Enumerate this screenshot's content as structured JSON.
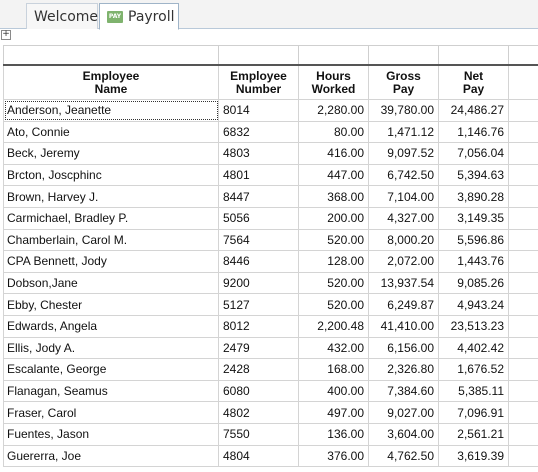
{
  "tabs": [
    {
      "label": "Welcome",
      "active": false
    },
    {
      "label": "Payroll",
      "active": true,
      "badge": "PAY"
    }
  ],
  "expander": "+",
  "columns": [
    {
      "line1": "Employee",
      "line2": "Name"
    },
    {
      "line1": "Employee",
      "line2": "Number"
    },
    {
      "line1": "Hours",
      "line2": "Worked"
    },
    {
      "line1": "Gross",
      "line2": "Pay"
    },
    {
      "line1": "Net",
      "line2": "Pay"
    }
  ],
  "rows": [
    {
      "name": "Anderson, Jeanette",
      "number": "8014",
      "hours": "2,280.00",
      "gross": "39,780.00",
      "net": "24,486.27"
    },
    {
      "name": "Ato, Connie",
      "number": "6832",
      "hours": "80.00",
      "gross": "1,471.12",
      "net": "1,146.76"
    },
    {
      "name": "Beck, Jeremy",
      "number": "4803",
      "hours": "416.00",
      "gross": "9,097.52",
      "net": "7,056.04"
    },
    {
      "name": "Brcton, Joscphinc",
      "number": "4801",
      "hours": "447.00",
      "gross": "6,742.50",
      "net": "5,394.63"
    },
    {
      "name": "Brown, Harvey J.",
      "number": "8447",
      "hours": "368.00",
      "gross": "7,104.00",
      "net": "3,890.28"
    },
    {
      "name": "Carmichael, Bradley P.",
      "number": "5056",
      "hours": "200.00",
      "gross": "4,327.00",
      "net": "3,149.35"
    },
    {
      "name": "Chamberlain, Carol M.",
      "number": "7564",
      "hours": "520.00",
      "gross": "8,000.20",
      "net": "5,596.86"
    },
    {
      "name": "CPA Bennett, Jody",
      "number": "8446",
      "hours": "128.00",
      "gross": "2,072.00",
      "net": "1,443.76"
    },
    {
      "name": "Dobson,Jane",
      "number": "9200",
      "hours": "520.00",
      "gross": "13,937.54",
      "net": "9,085.26"
    },
    {
      "name": "Ebby, Chester",
      "number": "5127",
      "hours": "520.00",
      "gross": "6,249.87",
      "net": "4,943.24"
    },
    {
      "name": "Edwards, Angela",
      "number": "8012",
      "hours": "2,200.48",
      "gross": "41,410.00",
      "net": "23,513.23"
    },
    {
      "name": "Ellis, Jody A.",
      "number": "2479",
      "hours": "432.00",
      "gross": "6,156.00",
      "net": "4,402.42"
    },
    {
      "name": "Escalante, George",
      "number": "2428",
      "hours": "168.00",
      "gross": "2,326.80",
      "net": "1,676.52"
    },
    {
      "name": "Flanagan, Seamus",
      "number": "6080",
      "hours": "400.00",
      "gross": "7,384.60",
      "net": "5,385.11"
    },
    {
      "name": "Fraser, Carol",
      "number": "4802",
      "hours": "497.00",
      "gross": "9,027.00",
      "net": "7,096.91"
    },
    {
      "name": "Fuentes, Jason",
      "number": "7550",
      "hours": "136.00",
      "gross": "3,604.00",
      "net": "2,561.21"
    },
    {
      "name": "Guererra, Joe",
      "number": "4804",
      "hours": "376.00",
      "gross": "4,762.50",
      "net": "3,619.39"
    }
  ]
}
